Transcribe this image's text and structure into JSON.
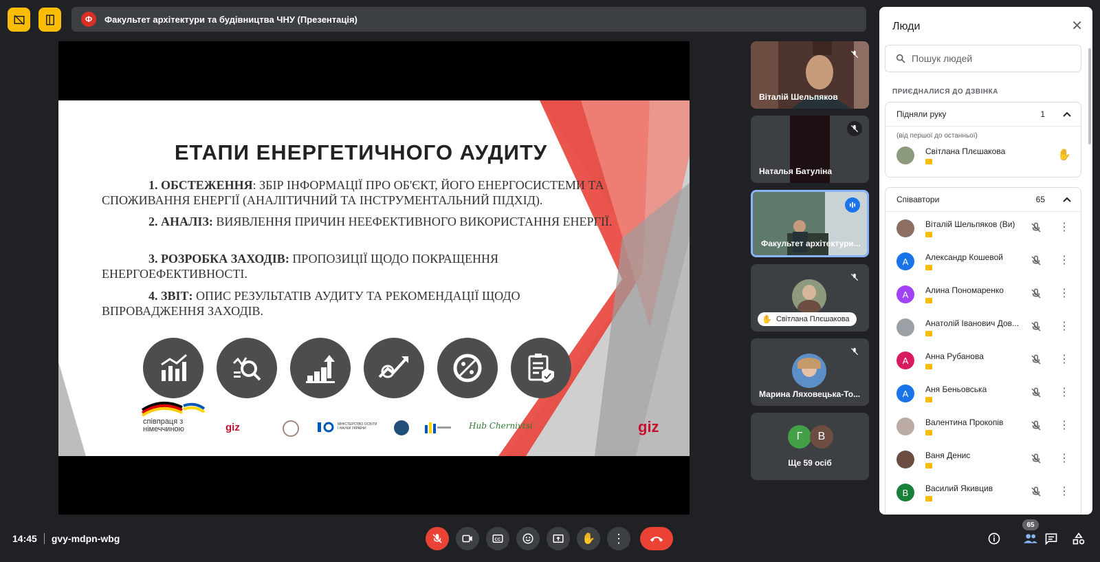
{
  "meeting": {
    "title": "Факультет архітектури та будівництва ЧНУ (Презентація)",
    "presenter_initial": "Ф",
    "time": "14:45",
    "code": "gvy-mdpn-wbg"
  },
  "slide": {
    "title": "ЕТАПИ ЕНЕРГЕТИЧНОГО АУДИТУ",
    "points": [
      {
        "label": "1. ОБСТЕЖЕННЯ",
        "text": ": ЗБІР ІНФОРМАЦІЇ ПРО ОБ'ЄКТ, ЙОГО ЕНЕРГОСИСТЕМИ ТА СПОЖИВАННЯ ЕНЕРГІЇ (АНАЛІТИЧНИЙ ТА ІНСТРУМЕНТАЛЬНИЙ ПІДХІД)."
      },
      {
        "label": "2. АНАЛІЗ:",
        "text": " ВИЯВЛЕННЯ ПРИЧИН НЕЕФЕКТИВНОГО ВИКОРИСТАННЯ ЕНЕРГІЇ."
      },
      {
        "label": "3. РОЗРОБКА ЗАХОДІВ:",
        "text": " ПРОПОЗИЦІЇ ЩОДО ПОКРАЩЕННЯ ЕНЕРГОЕФЕКТИВНОСТІ."
      },
      {
        "label": "4. ЗВІТ:",
        "text": " ОПИС РЕЗУЛЬТАТІВ АУДИТУ ТА РЕКОМЕНДАЦІЇ ЩОДО ВПРОВАДЖЕННЯ ЗАХОДІВ."
      }
    ],
    "logos": {
      "cooperation": "співпраця з німеччиною",
      "giz_small": "giz",
      "ministry": "МІНІСТЕРСТВО ОСВІТИ І НАУКИ УКРАЇНИ",
      "hub": "Hub Chernivtsi",
      "giz_corner": "giz"
    }
  },
  "tiles": [
    {
      "name": "Віталій Шельпяков"
    },
    {
      "name": "Наталья Батуліна"
    },
    {
      "name": "Факультет архітектури..."
    },
    {
      "name": "Світлана Плєшакова"
    },
    {
      "name": "Марина Ляховецька-То..."
    },
    {
      "more_initials": [
        "Г",
        "В"
      ],
      "more_label": "Ще 59 осіб"
    }
  ],
  "people_panel": {
    "title": "Люди",
    "search_placeholder": "Пошук людей",
    "section": "ПРИЄДНАЛИСЯ ДО ДЗВІНКА",
    "raised": {
      "label": "Підняли руку",
      "count": "1",
      "subtitle": "(від першої до останньої)",
      "person": "Світлана Плєшакова"
    },
    "contributors": {
      "label": "Співавтори",
      "count": "65",
      "people": [
        {
          "name": "Віталій Шельпяков (Ви)",
          "initial": "",
          "color": "#8d6e63"
        },
        {
          "name": "Александр Кошевой",
          "initial": "A",
          "color": "#1a73e8"
        },
        {
          "name": "Алина Пономаренко",
          "initial": "A",
          "color": "#a142f4"
        },
        {
          "name": "Анатолій Іванович Дов...",
          "initial": "",
          "color": "#9aa0a6"
        },
        {
          "name": "Анна Рубанова",
          "initial": "A",
          "color": "#d81b60"
        },
        {
          "name": "Аня Беньовська",
          "initial": "A",
          "color": "#1a73e8"
        },
        {
          "name": "Валентина Прокопів",
          "initial": "",
          "color": "#bcaaa4"
        },
        {
          "name": "Ваня Денис",
          "initial": "",
          "color": "#6d4c41"
        },
        {
          "name": "Василий Якивцив",
          "initial": "B",
          "color": "#188038"
        }
      ]
    }
  },
  "controls": {
    "participants_count": "65"
  },
  "colors": {
    "accent_red": "#ea4335",
    "yellow": "#fbbc04",
    "bg": "#202124"
  }
}
